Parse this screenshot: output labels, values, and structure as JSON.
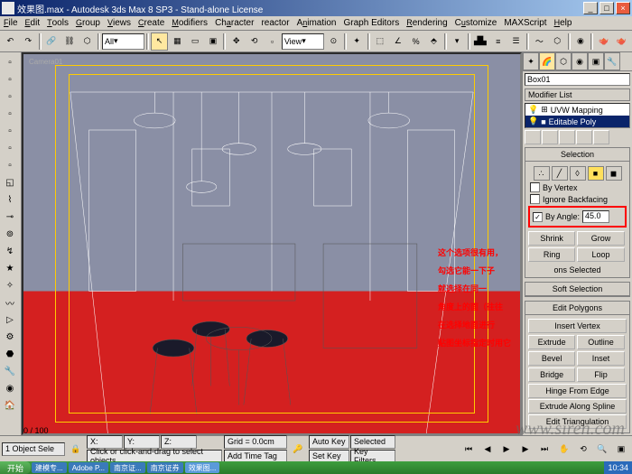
{
  "titlebar": {
    "icon": "3dsmax-icon",
    "text": "效果图.max - Autodesk 3ds Max 8 SP3 - Stand-alone License"
  },
  "menubar": {
    "items": [
      "File",
      "Edit",
      "Tools",
      "Group",
      "Views",
      "Create",
      "Modifiers",
      "Character",
      "reactor",
      "Animation",
      "Graph Editors",
      "Rendering",
      "Customize",
      "MAXScript",
      "Help"
    ]
  },
  "toolbar": {
    "dropdown1": "All",
    "dropdown2": "View"
  },
  "viewport": {
    "camera_label": "Camera01",
    "timeline": "0 / 100"
  },
  "annotation": {
    "lines": [
      "这个选项很有用，",
      "勾选它能一下子",
      "就选择在同一",
      "角度上的面（往往",
      "在选择地面进行",
      "贴图坐标指定时用它"
    ]
  },
  "panel": {
    "object_name": "Box01",
    "modifier_label": "Modifier List",
    "modifiers": [
      {
        "name": "UVW Mapping",
        "sel": false
      },
      {
        "name": "Editable Poly",
        "sel": true
      }
    ],
    "selection": {
      "title": "Selection",
      "by_vertex": "By Vertex",
      "ignore_backfacing": "Ignore Backfacing",
      "by_angle": "By Angle:",
      "by_angle_value": "45.0",
      "shrink": "Shrink",
      "grow": "Grow",
      "ring": "Ring",
      "loop": "Loop",
      "obj_selected": "ons Selected"
    },
    "softsel": {
      "title": "Soft Selection"
    },
    "editpoly": {
      "title": "Edit Polygons",
      "insert_vertex": "Insert Vertex",
      "extrude": "Extrude",
      "outline": "Outline",
      "bevel": "Bevel",
      "inset": "Inset",
      "bridge": "Bridge",
      "flip": "Flip",
      "hinge": "Hinge From Edge",
      "extrude_spline": "Extrude Along Spline",
      "edit_tri": "Edit Triangulation"
    }
  },
  "status": {
    "selected": "1 Object Sele",
    "prompt": "Click or click-and-drag to select objects",
    "x": "",
    "y": "",
    "z": "",
    "grid": "Grid = 0.0cm",
    "add_time": "Add Time Tag",
    "auto_key": "Auto Key",
    "set_key": "Set Key",
    "selected_label": "Selected",
    "key_filters": "Key Filters..."
  },
  "taskbar": {
    "start": "开始",
    "items": [
      "建模专...",
      "Adobe P...",
      "南京证...",
      "南京证券",
      "效果图..."
    ],
    "time": "10:34"
  },
  "watermark": "www.siren.com"
}
